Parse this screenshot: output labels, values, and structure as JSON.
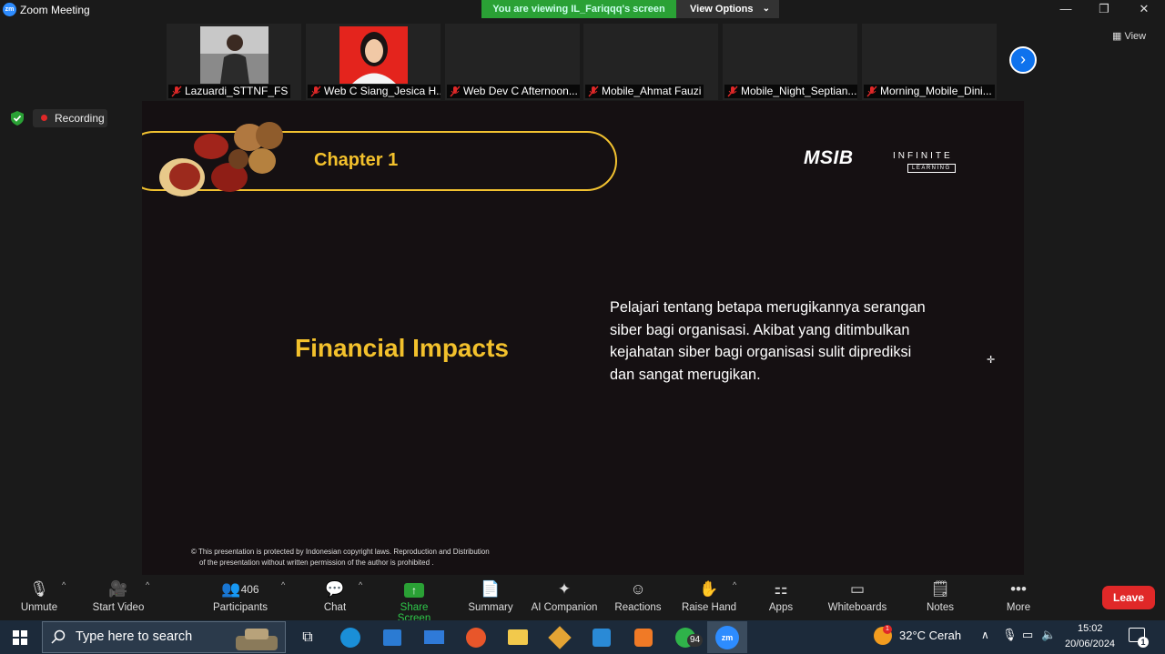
{
  "window": {
    "app_title": "Zoom Meeting",
    "app_logo": "zm",
    "viewing_banner": "You are viewing IL_Fariqqq's screen",
    "view_options": "View Options",
    "controls": {
      "minimize": "—",
      "restore": "❐",
      "close": "✕"
    }
  },
  "gallery": {
    "participants": [
      {
        "name": "Lazuardi_STTNF_FS"
      },
      {
        "name": "Web C Siang_Jesica H..."
      },
      {
        "name": "Web Dev C Afternoon..."
      },
      {
        "name": "Mobile_Ahmat Fauzi"
      },
      {
        "name": "Mobile_Night_Septian..."
      },
      {
        "name": "Morning_Mobile_Dini..."
      }
    ],
    "next_icon": "chevron-right-icon",
    "view_label": "View"
  },
  "status": {
    "recording_label": "Recording"
  },
  "slide": {
    "chapter": "Chapter 1",
    "brand_msib": "MSIB",
    "brand_infinite": "INFINITE",
    "brand_learning": "LEARNING",
    "heading": "Financial Impacts",
    "body": "Pelajari tentang betapa merugikannya serangan siber bagi organisasi. Akibat yang ditimbulkan kejahatan siber bagi organisasi sulit diprediksi dan sangat merugikan.",
    "copyright_line1": "© This presentation is protected by Indonesian copyright laws. Reproduction and Distribution",
    "copyright_line2": "of the presentation without written permission of the author is prohibited .",
    "colors": {
      "accent": "#f3c12c",
      "background": "#151012"
    }
  },
  "toolbar": {
    "unmute": "Unmute",
    "start_video": "Start Video",
    "participants": "Participants",
    "participant_count": "406",
    "chat": "Chat",
    "share_screen": "Share Screen",
    "summary": "Summary",
    "ai_companion": "AI Companion",
    "reactions": "Reactions",
    "raise_hand": "Raise Hand",
    "apps": "Apps",
    "whiteboards": "Whiteboards",
    "notes": "Notes",
    "more": "More",
    "leave": "Leave",
    "share_color": "#2aa135",
    "leave_color": "#e02828"
  },
  "taskbar": {
    "search_placeholder": "Type here to search",
    "whatsapp_badge": "94",
    "weather_badge": "1",
    "temperature": "32°C",
    "weather": "Cerah",
    "time": "15:02",
    "date": "20/06/2024",
    "notification_badge": "1"
  }
}
